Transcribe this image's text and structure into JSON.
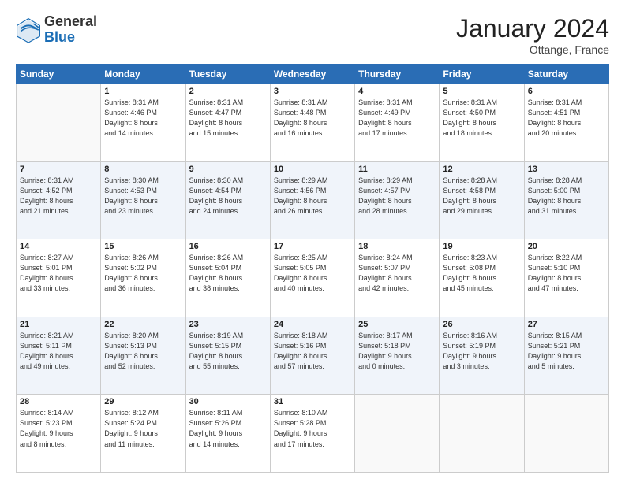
{
  "header": {
    "logo_general": "General",
    "logo_blue": "Blue",
    "month_title": "January 2024",
    "location": "Ottange, France"
  },
  "days_of_week": [
    "Sunday",
    "Monday",
    "Tuesday",
    "Wednesday",
    "Thursday",
    "Friday",
    "Saturday"
  ],
  "weeks": [
    [
      {
        "day": "",
        "info": ""
      },
      {
        "day": "1",
        "info": "Sunrise: 8:31 AM\nSunset: 4:46 PM\nDaylight: 8 hours\nand 14 minutes."
      },
      {
        "day": "2",
        "info": "Sunrise: 8:31 AM\nSunset: 4:47 PM\nDaylight: 8 hours\nand 15 minutes."
      },
      {
        "day": "3",
        "info": "Sunrise: 8:31 AM\nSunset: 4:48 PM\nDaylight: 8 hours\nand 16 minutes."
      },
      {
        "day": "4",
        "info": "Sunrise: 8:31 AM\nSunset: 4:49 PM\nDaylight: 8 hours\nand 17 minutes."
      },
      {
        "day": "5",
        "info": "Sunrise: 8:31 AM\nSunset: 4:50 PM\nDaylight: 8 hours\nand 18 minutes."
      },
      {
        "day": "6",
        "info": "Sunrise: 8:31 AM\nSunset: 4:51 PM\nDaylight: 8 hours\nand 20 minutes."
      }
    ],
    [
      {
        "day": "7",
        "info": ""
      },
      {
        "day": "8",
        "info": "Sunrise: 8:30 AM\nSunset: 4:53 PM\nDaylight: 8 hours\nand 23 minutes."
      },
      {
        "day": "9",
        "info": "Sunrise: 8:30 AM\nSunset: 4:54 PM\nDaylight: 8 hours\nand 24 minutes."
      },
      {
        "day": "10",
        "info": "Sunrise: 8:29 AM\nSunset: 4:56 PM\nDaylight: 8 hours\nand 26 minutes."
      },
      {
        "day": "11",
        "info": "Sunrise: 8:29 AM\nSunset: 4:57 PM\nDaylight: 8 hours\nand 28 minutes."
      },
      {
        "day": "12",
        "info": "Sunrise: 8:28 AM\nSunset: 4:58 PM\nDaylight: 8 hours\nand 29 minutes."
      },
      {
        "day": "13",
        "info": "Sunrise: 8:28 AM\nSunset: 5:00 PM\nDaylight: 8 hours\nand 31 minutes."
      }
    ],
    [
      {
        "day": "14",
        "info": ""
      },
      {
        "day": "15",
        "info": "Sunrise: 8:26 AM\nSunset: 5:02 PM\nDaylight: 8 hours\nand 36 minutes."
      },
      {
        "day": "16",
        "info": "Sunrise: 8:26 AM\nSunset: 5:04 PM\nDaylight: 8 hours\nand 38 minutes."
      },
      {
        "day": "17",
        "info": "Sunrise: 8:25 AM\nSunset: 5:05 PM\nDaylight: 8 hours\nand 40 minutes."
      },
      {
        "day": "18",
        "info": "Sunrise: 8:24 AM\nSunset: 5:07 PM\nDaylight: 8 hours\nand 42 minutes."
      },
      {
        "day": "19",
        "info": "Sunrise: 8:23 AM\nSunset: 5:08 PM\nDaylight: 8 hours\nand 45 minutes."
      },
      {
        "day": "20",
        "info": "Sunrise: 8:22 AM\nSunset: 5:10 PM\nDaylight: 8 hours\nand 47 minutes."
      }
    ],
    [
      {
        "day": "21",
        "info": ""
      },
      {
        "day": "22",
        "info": "Sunrise: 8:20 AM\nSunset: 5:13 PM\nDaylight: 8 hours\nand 52 minutes."
      },
      {
        "day": "23",
        "info": "Sunrise: 8:19 AM\nSunset: 5:15 PM\nDaylight: 8 hours\nand 55 minutes."
      },
      {
        "day": "24",
        "info": "Sunrise: 8:18 AM\nSunset: 5:16 PM\nDaylight: 8 hours\nand 57 minutes."
      },
      {
        "day": "25",
        "info": "Sunrise: 8:17 AM\nSunset: 5:18 PM\nDaylight: 9 hours\nand 0 minutes."
      },
      {
        "day": "26",
        "info": "Sunrise: 8:16 AM\nSunset: 5:19 PM\nDaylight: 9 hours\nand 3 minutes."
      },
      {
        "day": "27",
        "info": "Sunrise: 8:15 AM\nSunset: 5:21 PM\nDaylight: 9 hours\nand 5 minutes."
      }
    ],
    [
      {
        "day": "28",
        "info": "Sunrise: 8:14 AM\nSunset: 5:23 PM\nDaylight: 9 hours\nand 8 minutes."
      },
      {
        "day": "29",
        "info": "Sunrise: 8:12 AM\nSunset: 5:24 PM\nDaylight: 9 hours\nand 11 minutes."
      },
      {
        "day": "30",
        "info": "Sunrise: 8:11 AM\nSunset: 5:26 PM\nDaylight: 9 hours\nand 14 minutes."
      },
      {
        "day": "31",
        "info": "Sunrise: 8:10 AM\nSunset: 5:28 PM\nDaylight: 9 hours\nand 17 minutes."
      },
      {
        "day": "",
        "info": ""
      },
      {
        "day": "",
        "info": ""
      },
      {
        "day": "",
        "info": ""
      }
    ]
  ],
  "week1_day7_info": "Sunrise: 8:31 AM\nSunset: 4:52 PM\nDaylight: 8 hours\nand 21 minutes.",
  "week2_day14_info": "Sunrise: 8:27 AM\nSunset: 5:01 PM\nDaylight: 8 hours\nand 33 minutes.",
  "week3_day21_info": "Sunrise: 8:21 AM\nSunset: 5:11 PM\nDaylight: 8 hours\nand 49 minutes."
}
